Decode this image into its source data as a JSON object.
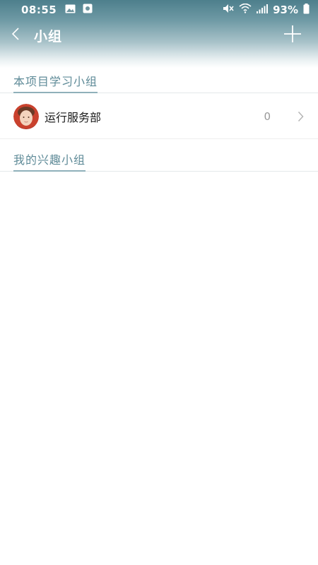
{
  "status_bar": {
    "time": "08:55",
    "battery_percent": "93%",
    "icons": [
      "gallery-icon",
      "screen-record-icon",
      "mute-icon",
      "wifi-icon",
      "signal-icon",
      "battery-icon"
    ]
  },
  "header": {
    "title": "小组",
    "back_icon": "back-chevron-icon",
    "add_icon": "plus-icon"
  },
  "sections": [
    {
      "title": "本项目学习小组",
      "groups": [
        {
          "name": "运行服务部",
          "count": "0",
          "avatar_icon": "avatar-icon"
        }
      ]
    },
    {
      "title": "我的兴趣小组",
      "groups": []
    }
  ],
  "colors": {
    "header_gradient_top": "#4d7f8c",
    "section_title": "#5f8b98",
    "section_underline": "#8fb0ba"
  }
}
